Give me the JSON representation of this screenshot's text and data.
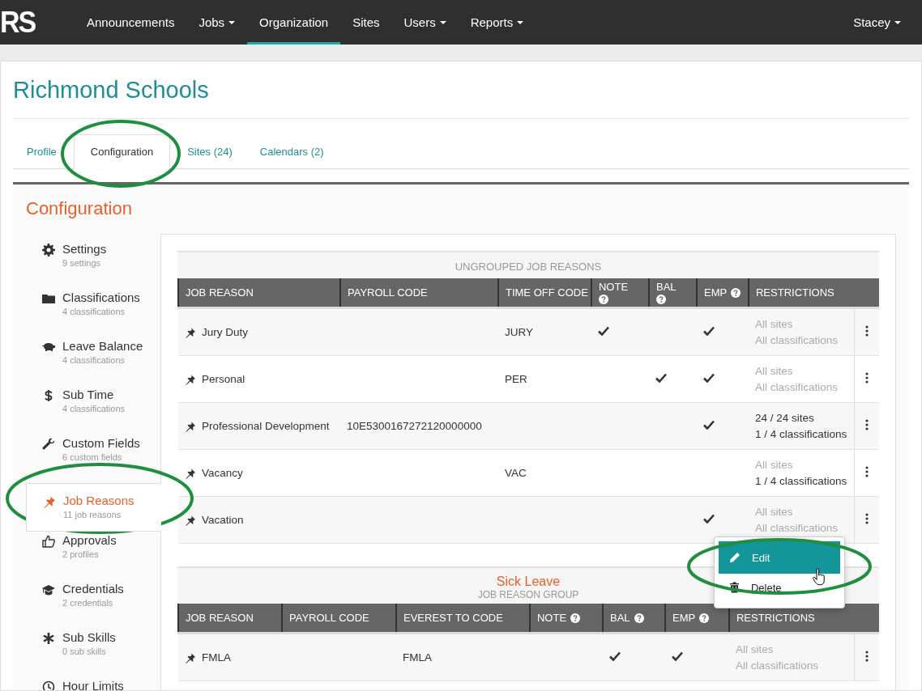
{
  "logo": "RS",
  "nav": [
    {
      "label": "Announcements",
      "dropdown": false,
      "selected": false
    },
    {
      "label": "Jobs",
      "dropdown": true,
      "selected": false
    },
    {
      "label": "Organization",
      "dropdown": false,
      "selected": true
    },
    {
      "label": "Sites",
      "dropdown": false,
      "selected": false
    },
    {
      "label": "Users",
      "dropdown": true,
      "selected": false
    },
    {
      "label": "Reports",
      "dropdown": true,
      "selected": false
    }
  ],
  "user_menu": {
    "label": "Stacey"
  },
  "page_title": "Richmond Schools",
  "tabs": [
    {
      "label": "Profile",
      "selected": false
    },
    {
      "label": "Configuration",
      "selected": true
    },
    {
      "label": "Sites (24)",
      "selected": false
    },
    {
      "label": "Calendars (2)",
      "selected": false
    }
  ],
  "section_title": "Configuration",
  "sidebar": {
    "items": [
      {
        "label": "Settings",
        "count": "9 settings",
        "selected": false
      },
      {
        "label": "Classifications",
        "count": "4 classifications",
        "selected": false
      },
      {
        "label": "Leave Balance",
        "count": "4 classifications",
        "selected": false
      },
      {
        "label": "Sub Time",
        "count": "4 classifications",
        "selected": false
      },
      {
        "label": "Custom Fields",
        "count": "6 custom fields",
        "selected": false
      },
      {
        "label": "Job Reasons",
        "count": "11 job reasons",
        "selected": true
      },
      {
        "label": "Approvals",
        "count": "2 profiles",
        "selected": false
      },
      {
        "label": "Credentials",
        "count": "2 credentials",
        "selected": false
      },
      {
        "label": "Sub Skills",
        "count": "0 sub skills",
        "selected": false
      },
      {
        "label": "Hour Limits",
        "selected": false
      }
    ]
  },
  "groups": [
    {
      "kind": "ungrouped",
      "title": "UNGROUPED JOB REASONS",
      "columns": [
        {
          "label": "JOB REASON",
          "kind": "name",
          "help": false
        },
        {
          "label": "PAYROLL CODE",
          "kind": "payroll",
          "help": false
        },
        {
          "label": "TIME OFF CODE",
          "kind": "code",
          "help": false
        },
        {
          "label": "NOTE",
          "kind": "check",
          "help": true
        },
        {
          "label": "BAL",
          "kind": "check",
          "help": true
        },
        {
          "label": "EMP",
          "kind": "check",
          "help": true
        },
        {
          "label": "RESTRICTIONS",
          "kind": "restrictions",
          "help": false
        }
      ],
      "rows": [
        {
          "name": "Jury Duty",
          "code": "JURY",
          "checks": [
            true,
            false,
            true
          ],
          "restrictions": [
            {
              "text": "All sites",
              "limited": false
            },
            {
              "text": "All classifications",
              "limited": false
            }
          ]
        },
        {
          "name": "Personal",
          "code": "PER",
          "checks": [
            false,
            true,
            true
          ],
          "restrictions": [
            {
              "text": "All sites",
              "limited": false
            },
            {
              "text": "All classifications",
              "limited": false
            }
          ]
        },
        {
          "name": "Professional Development",
          "payroll_code": "10E5300167272120000000",
          "checks": [
            false,
            false,
            true
          ],
          "restrictions": [
            {
              "text": "24 / 24 sites",
              "limited": true
            },
            {
              "text": "1 / 4 classifications",
              "limited": true
            }
          ]
        },
        {
          "name": "Vacancy",
          "code": "VAC",
          "checks": [
            false,
            false,
            false
          ],
          "restrictions": [
            {
              "text": "All sites",
              "limited": false
            },
            {
              "text": "1 / 4 classifications",
              "limited": true
            }
          ]
        },
        {
          "name": "Vacation",
          "checks": [
            false,
            false,
            true
          ],
          "restrictions": [
            {
              "text": "All sites",
              "limited": false
            },
            {
              "text": "All classifications",
              "limited": false
            }
          ]
        }
      ]
    },
    {
      "kind": "group",
      "title": "Sick Leave",
      "subtitle": "JOB REASON GROUP",
      "columns": [
        {
          "label": "JOB REASON",
          "kind": "name",
          "help": false
        },
        {
          "label": "PAYROLL CODE",
          "kind": "payroll",
          "help": false
        },
        {
          "label": "EVEREST TO CODE",
          "kind": "code",
          "help": false
        },
        {
          "label": "NOTE",
          "kind": "check",
          "help": true
        },
        {
          "label": "BAL",
          "kind": "check",
          "help": true
        },
        {
          "label": "EMP",
          "kind": "check",
          "help": true
        },
        {
          "label": "RESTRICTIONS",
          "kind": "restrictions",
          "help": false
        }
      ],
      "rows": [
        {
          "name": "FMLA",
          "code": "FMLA",
          "checks": [
            false,
            true,
            true
          ],
          "restrictions": [
            {
              "text": "All sites",
              "limited": false
            },
            {
              "text": "All classifications",
              "limited": false
            }
          ]
        }
      ]
    }
  ],
  "row_menu": {
    "items": [
      {
        "label": "Edit",
        "highlighted": true
      },
      {
        "label": "Delete",
        "highlighted": false
      }
    ]
  }
}
